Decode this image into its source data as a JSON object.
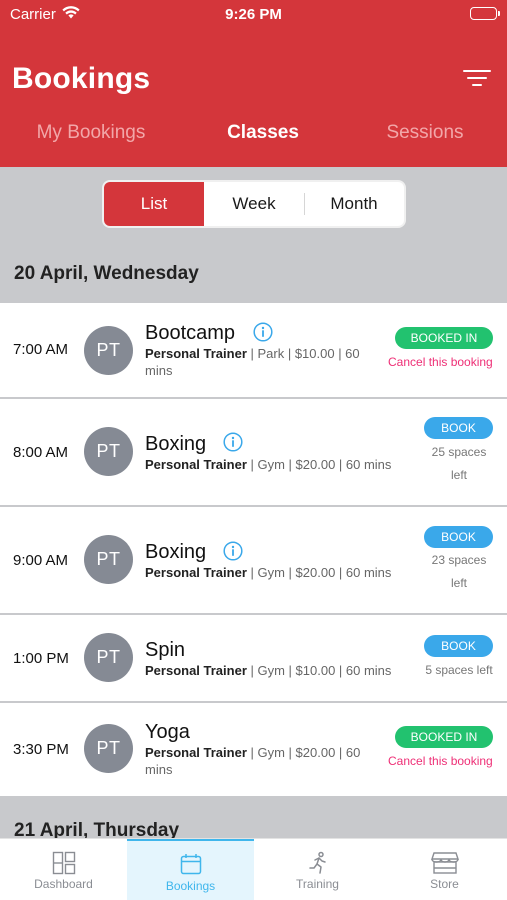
{
  "status_bar": {
    "carrier": "Carrier",
    "time": "9:26 PM"
  },
  "header": {
    "title": "Bookings"
  },
  "tabs": [
    {
      "label": "My Bookings",
      "active": false
    },
    {
      "label": "Classes",
      "active": true
    },
    {
      "label": "Sessions",
      "active": false
    }
  ],
  "view_modes": [
    {
      "label": "List",
      "active": true
    },
    {
      "label": "Week",
      "active": false
    },
    {
      "label": "Month",
      "active": false
    }
  ],
  "days": [
    {
      "label": "20 April, Wednesday",
      "classes": [
        {
          "time": "7:00 AM",
          "avatar": "PT",
          "name": "Bootcamp",
          "trainer": "Personal Trainer",
          "details": " | Park | $10.00 | 60",
          "details2": "mins",
          "status": "BOOKED IN",
          "action": "Cancel this booking"
        },
        {
          "time": "8:00 AM",
          "avatar": "PT",
          "name": "Boxing",
          "trainer": "Personal Trainer",
          "details": " | Gym | $20.00 | 60 mins",
          "status": "BOOK",
          "spaces1": "25 spaces",
          "spaces2": "left"
        },
        {
          "time": "9:00 AM",
          "avatar": "PT",
          "name": "Boxing",
          "trainer": "Personal Trainer",
          "details": " | Gym | $20.00 | 60 mins",
          "status": "BOOK",
          "spaces1": "23 spaces",
          "spaces2": "left"
        },
        {
          "time": "1:00 PM",
          "avatar": "PT",
          "name": "Spin",
          "trainer": "Personal Trainer",
          "details": " | Gym | $10.00 | 60 mins",
          "status": "BOOK",
          "spaces1": "5 spaces left"
        },
        {
          "time": "3:30 PM",
          "avatar": "PT",
          "name": "Yoga",
          "trainer": "Personal Trainer",
          "details": " | Gym | $20.00 | 60",
          "details2": "mins",
          "status": "BOOKED IN",
          "action": "Cancel this booking"
        }
      ]
    },
    {
      "label": "21 April, Thursday"
    }
  ],
  "tab_bar": [
    {
      "label": "Dashboard",
      "icon": "dashboard-icon",
      "active": false
    },
    {
      "label": "Bookings",
      "icon": "calendar-icon",
      "active": true
    },
    {
      "label": "Training",
      "icon": "running-icon",
      "active": false
    },
    {
      "label": "Store",
      "icon": "store-icon",
      "active": false
    }
  ],
  "colors": {
    "brand_red": "#d4363b",
    "booked_green": "#22c26f",
    "book_blue": "#3aa8ea",
    "cancel_pink": "#ee2f76",
    "tab_active": "#3fb6ec"
  }
}
